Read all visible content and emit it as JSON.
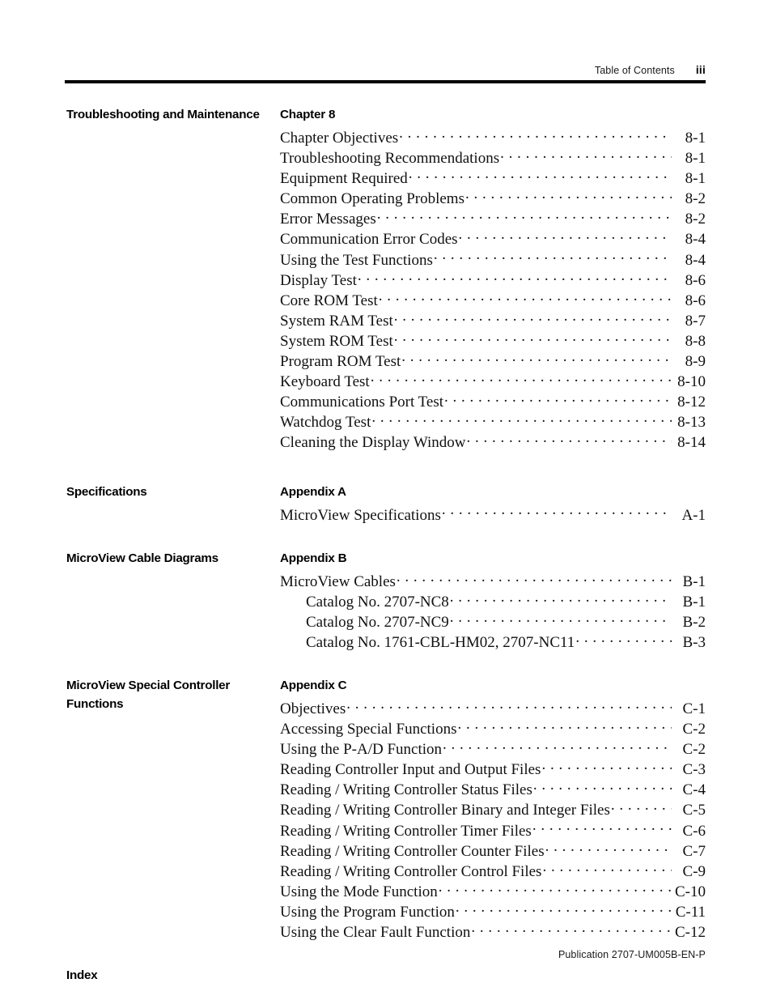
{
  "header": {
    "title": "Table of Contents",
    "folio": "iii"
  },
  "footer": {
    "publication": "Publication 2707-UM005B-EN-P"
  },
  "blocks": [
    {
      "label": "Troubleshooting and Maintenance",
      "title": "Chapter 8",
      "entries": [
        {
          "text": "Chapter Objectives",
          "page": "8-1",
          "indent": false
        },
        {
          "text": "Troubleshooting Recommendations",
          "page": "8-1",
          "indent": false
        },
        {
          "text": "Equipment Required",
          "page": "8-1",
          "indent": false
        },
        {
          "text": "Common Operating Problems",
          "page": "8-2",
          "indent": false
        },
        {
          "text": "Error Messages",
          "page": "8-2",
          "indent": false
        },
        {
          "text": "Communication Error Codes",
          "page": "8-4",
          "indent": false
        },
        {
          "text": "Using the Test Functions",
          "page": "8-4",
          "indent": false
        },
        {
          "text": "Display Test",
          "page": "8-6",
          "indent": false
        },
        {
          "text": "Core ROM Test",
          "page": "8-6",
          "indent": false
        },
        {
          "text": "System RAM Test",
          "page": "8-7",
          "indent": false
        },
        {
          "text": "System ROM Test",
          "page": "8-8",
          "indent": false
        },
        {
          "text": "Program ROM Test",
          "page": "8-9",
          "indent": false
        },
        {
          "text": "Keyboard Test",
          "page": "8-10",
          "indent": false
        },
        {
          "text": "Communications Port Test",
          "page": "8-12",
          "indent": false
        },
        {
          "text": "Watchdog Test",
          "page": "8-13",
          "indent": false
        },
        {
          "text": "Cleaning the Display Window",
          "page": "8-14",
          "indent": false
        }
      ]
    },
    {
      "label": "Specifications",
      "title": "Appendix A",
      "entries": [
        {
          "text": "MicroView Specifications",
          "page": "A-1",
          "indent": false
        }
      ]
    },
    {
      "label": "MicroView Cable Diagrams",
      "title": "Appendix B",
      "entries": [
        {
          "text": "MicroView Cables",
          "page": "B-1",
          "indent": false
        },
        {
          "text": "Catalog No. 2707-NC8",
          "page": "B-1",
          "indent": true
        },
        {
          "text": "Catalog No. 2707-NC9",
          "page": "B-2",
          "indent": true
        },
        {
          "text": "Catalog No. 1761-CBL-HM02, 2707-NC11",
          "page": "B-3",
          "indent": true
        }
      ]
    },
    {
      "label": "MicroView Special Controller Functions",
      "title": "Appendix C",
      "entries": [
        {
          "text": "Objectives",
          "page": "C-1",
          "indent": false
        },
        {
          "text": "Accessing Special Functions",
          "page": "C-2",
          "indent": false
        },
        {
          "text": "Using the P-A/D Function",
          "page": "C-2",
          "indent": false
        },
        {
          "text": "Reading Controller Input and Output Files",
          "page": "C-3",
          "indent": false
        },
        {
          "text": "Reading / Writing Controller Status Files",
          "page": "C-4",
          "indent": false
        },
        {
          "text": "Reading / Writing Controller Binary and Integer Files",
          "page": "C-5",
          "indent": false
        },
        {
          "text": "Reading / Writing Controller Timer Files",
          "page": "C-6",
          "indent": false
        },
        {
          "text": "Reading / Writing Controller Counter Files",
          "page": "C-7",
          "indent": false
        },
        {
          "text": "Reading / Writing Controller Control Files",
          "page": "C-9",
          "indent": false
        },
        {
          "text": "Using the Mode Function",
          "page": "C-10",
          "indent": false
        },
        {
          "text": "Using the Program Function",
          "page": "C-11",
          "indent": false
        },
        {
          "text": "Using the Clear Fault Function",
          "page": "C-12",
          "indent": false
        }
      ]
    },
    {
      "label": "Index",
      "title": "",
      "entries": []
    }
  ]
}
